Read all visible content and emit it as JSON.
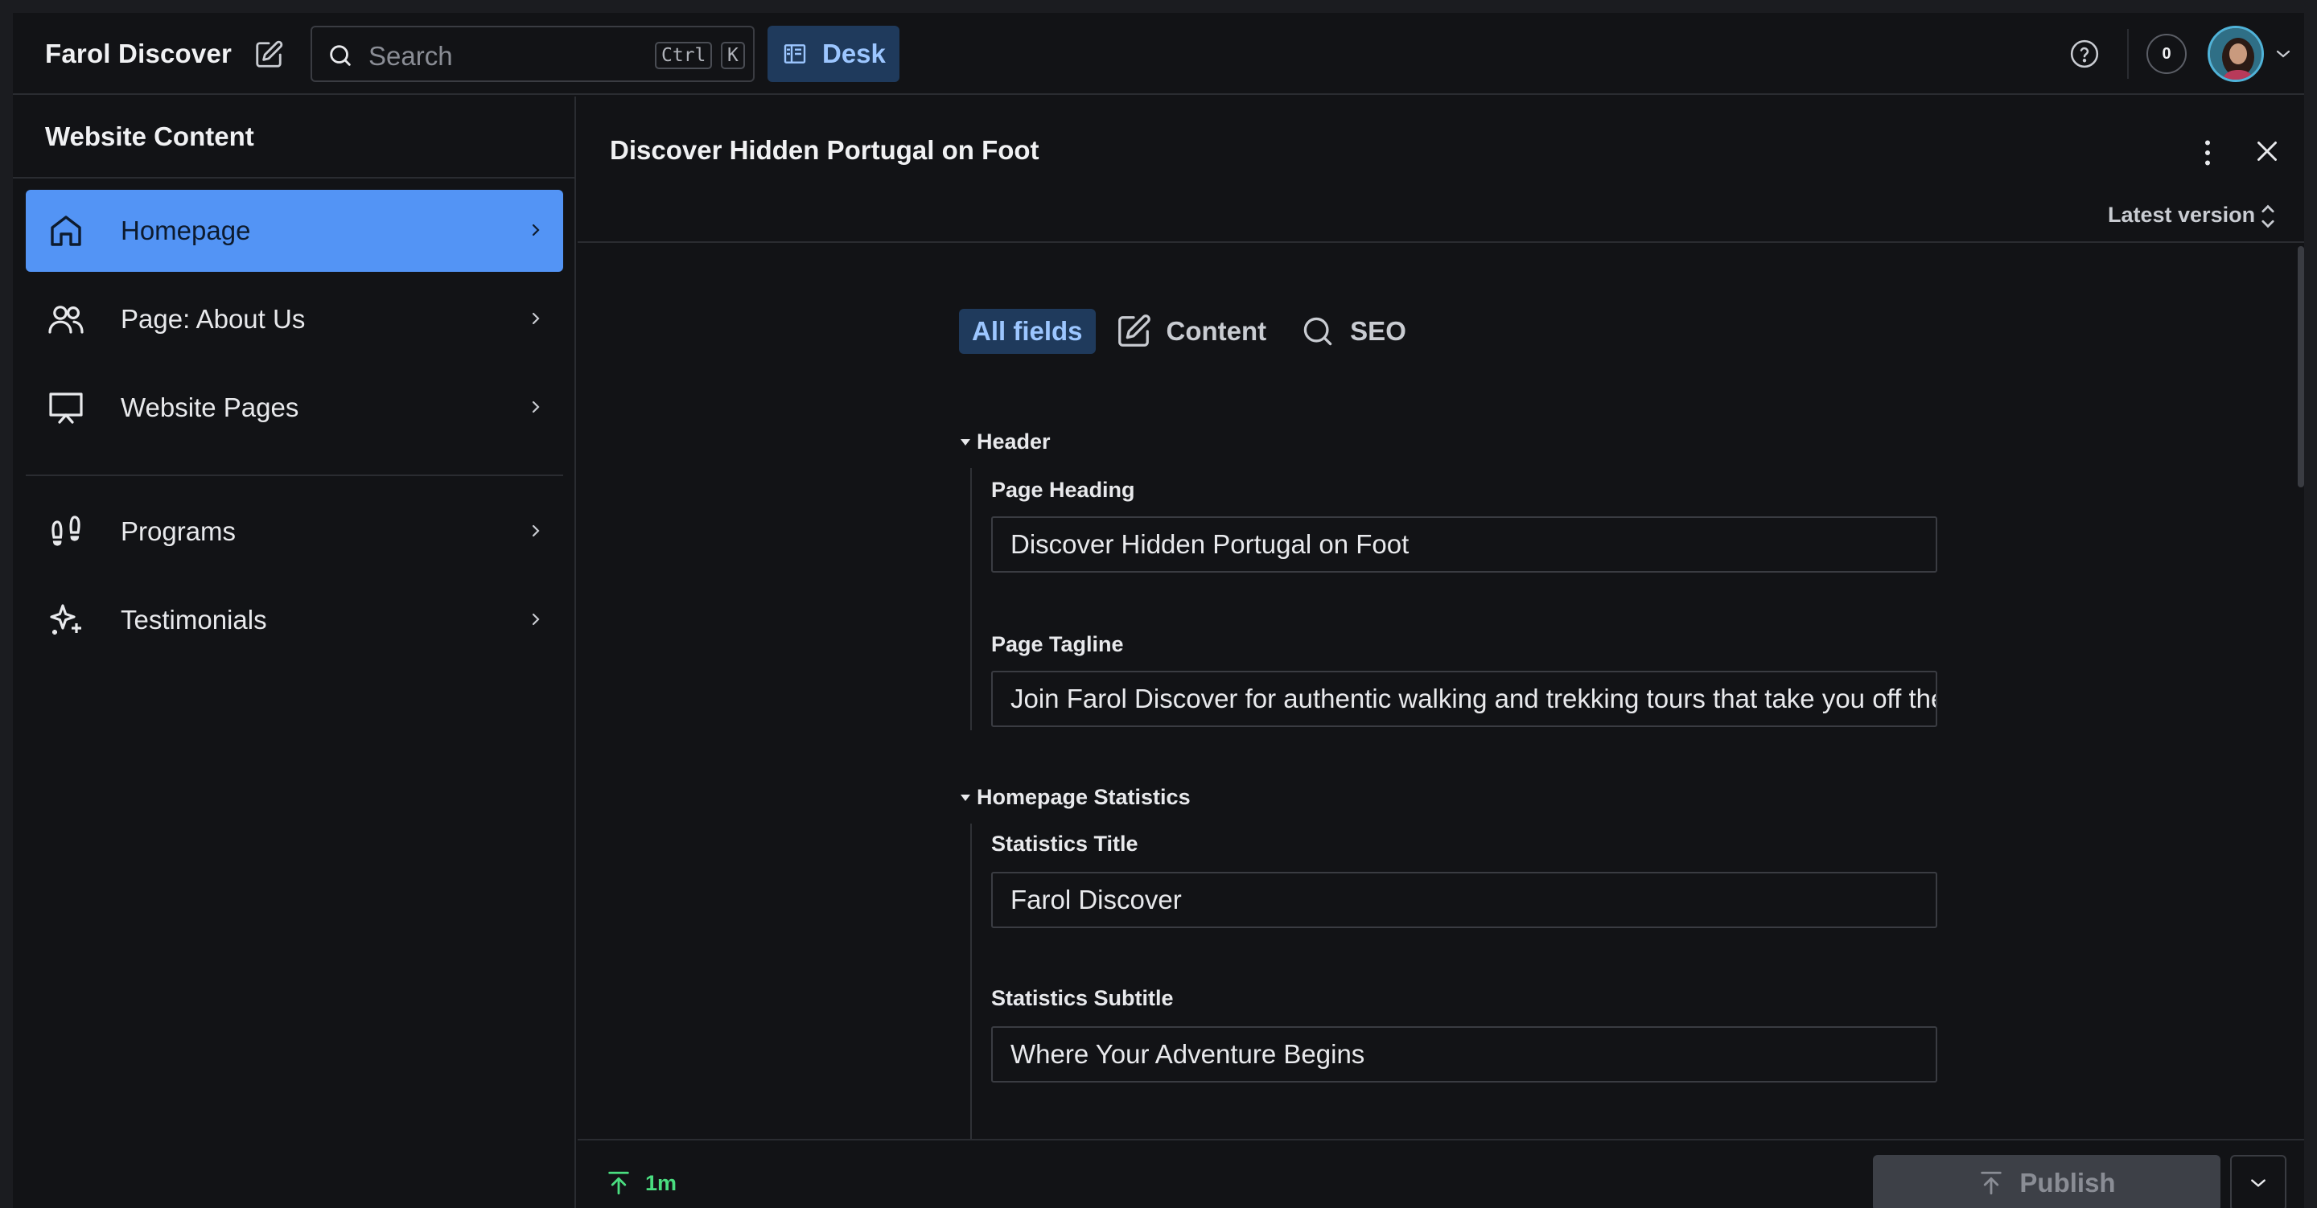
{
  "app": {
    "brand": "Farol Discover",
    "search_placeholder": "Search",
    "shortcut_ctrl": "Ctrl",
    "shortcut_key": "K",
    "desk_label": "Desk",
    "notification_count": "0"
  },
  "sidebar": {
    "title": "Website Content",
    "items": [
      {
        "label": "Homepage",
        "icon": "home-icon",
        "active": true
      },
      {
        "label": "Page: About Us",
        "icon": "users-icon",
        "active": false
      },
      {
        "label": "Website Pages",
        "icon": "presentation-icon",
        "active": false
      },
      {
        "label": "Programs",
        "icon": "footprints-icon",
        "active": false
      },
      {
        "label": "Testimonials",
        "icon": "sparkles-icon",
        "active": false
      }
    ]
  },
  "document": {
    "title": "Discover Hidden Portugal on Foot",
    "version_label": "Latest version",
    "tabs": [
      {
        "label": "All fields",
        "active": true
      },
      {
        "label": "Content",
        "icon": "edit-icon"
      },
      {
        "label": "SEO",
        "icon": "search-icon"
      }
    ],
    "sections": [
      {
        "title": "Header",
        "fields": [
          {
            "label": "Page Heading",
            "value": "Discover Hidden Portugal on Foot"
          },
          {
            "label": "Page Tagline",
            "value": "Join Farol Discover for authentic walking and trekking tours that take you off the"
          }
        ]
      },
      {
        "title": "Homepage Statistics",
        "fields": [
          {
            "label": "Statistics Title",
            "value": "Farol Discover"
          },
          {
            "label": "Statistics Subtitle",
            "value": "Where Your Adventure Begins"
          }
        ]
      }
    ]
  },
  "footer": {
    "sync_time": "1m",
    "publish_label": "Publish"
  },
  "colors": {
    "background": "#121316",
    "accent_active": "#5394f5",
    "tab_active_bg": "#1f3a5c",
    "tab_active_text": "#9cc6ff",
    "sync_green": "#4ade80"
  }
}
